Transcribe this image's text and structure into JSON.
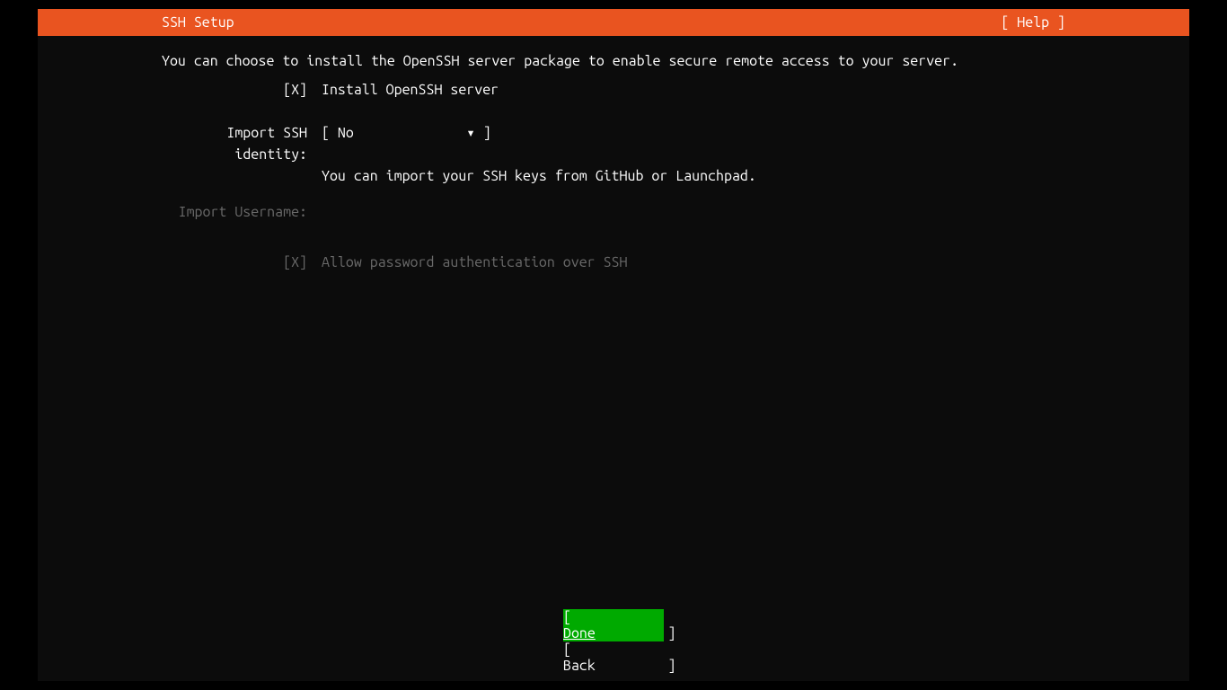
{
  "header": {
    "title": "SSH Setup",
    "help": "Help"
  },
  "intro": "You can choose to install the OpenSSH server package to enable secure remote access to your server.",
  "install_openssh": {
    "checkbox": "[X]",
    "label": "Install OpenSSH server"
  },
  "import_identity": {
    "label": "Import SSH identity:",
    "value": "No",
    "hint": "You can import your SSH keys from GitHub or Launchpad."
  },
  "import_username": {
    "label": "Import Username:"
  },
  "allow_password": {
    "checkbox": "[X]",
    "label": "Allow password authentication over SSH"
  },
  "buttons": {
    "done": "Done",
    "back": "Back"
  }
}
